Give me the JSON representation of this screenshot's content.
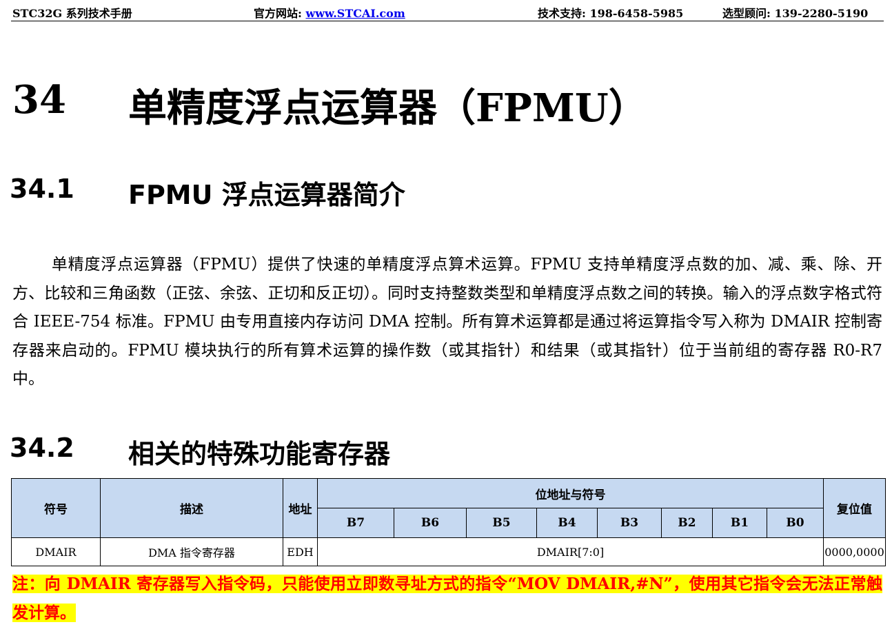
{
  "header": {
    "manual": "STC32G 系列技术手册",
    "website_label": "官方网站: ",
    "website_link": "www.STCAI.com",
    "support": "技术支持: 198-6458-5985",
    "consult": "选型顾问: 139-2280-5190"
  },
  "chapter": {
    "number": "34",
    "title": "单精度浮点运算器（FPMU）"
  },
  "section1": {
    "number": "34.1",
    "title": "FPMU 浮点运算器简介"
  },
  "paragraph": "单精度浮点运算器（FPMU）提供了快速的单精度浮点算术运算。FPMU 支持单精度浮点数的加、减、乘、除、开方、比较和三角函数（正弦、余弦、正切和反正切）。同时支持整数类型和单精度浮点数之间的转换。输入的浮点数字格式符合 IEEE-754 标准。FPMU 由专用直接内存访问 DMA 控制。所有算术运算都是通过将运算指令写入称为 DMAIR 控制寄存器来启动的。FPMU 模块执行的所有算术运算的操作数（或其指针）和结果（或其指针）位于当前组的寄存器 R0-R7 中。",
  "section2": {
    "number": "34.2",
    "title": "相关的特殊功能寄存器"
  },
  "table": {
    "headers": {
      "symbol": "符号",
      "description": "描述",
      "address": "地址",
      "bits_title": "位地址与符号",
      "bits": [
        "B7",
        "B6",
        "B5",
        "B4",
        "B3",
        "B2",
        "B1",
        "B0"
      ],
      "reset": "复位值"
    },
    "rows": [
      {
        "symbol": "DMAIR",
        "description": "DMA 指令寄存器",
        "address": "EDH",
        "bits": "DMAIR[7:0]",
        "reset": "0000,0000"
      }
    ]
  },
  "note": "注：向 DMAIR 寄存器写入指令码，只能使用立即数寻址方式的指令“MOV DMAIR,#N”，使用其它指令会无法正常触发计算。",
  "colors": {
    "table_header_bg": "#c6d9f1",
    "note_text": "#ff0000",
    "note_highlight": "#ffff00",
    "link": "#0000ee"
  }
}
